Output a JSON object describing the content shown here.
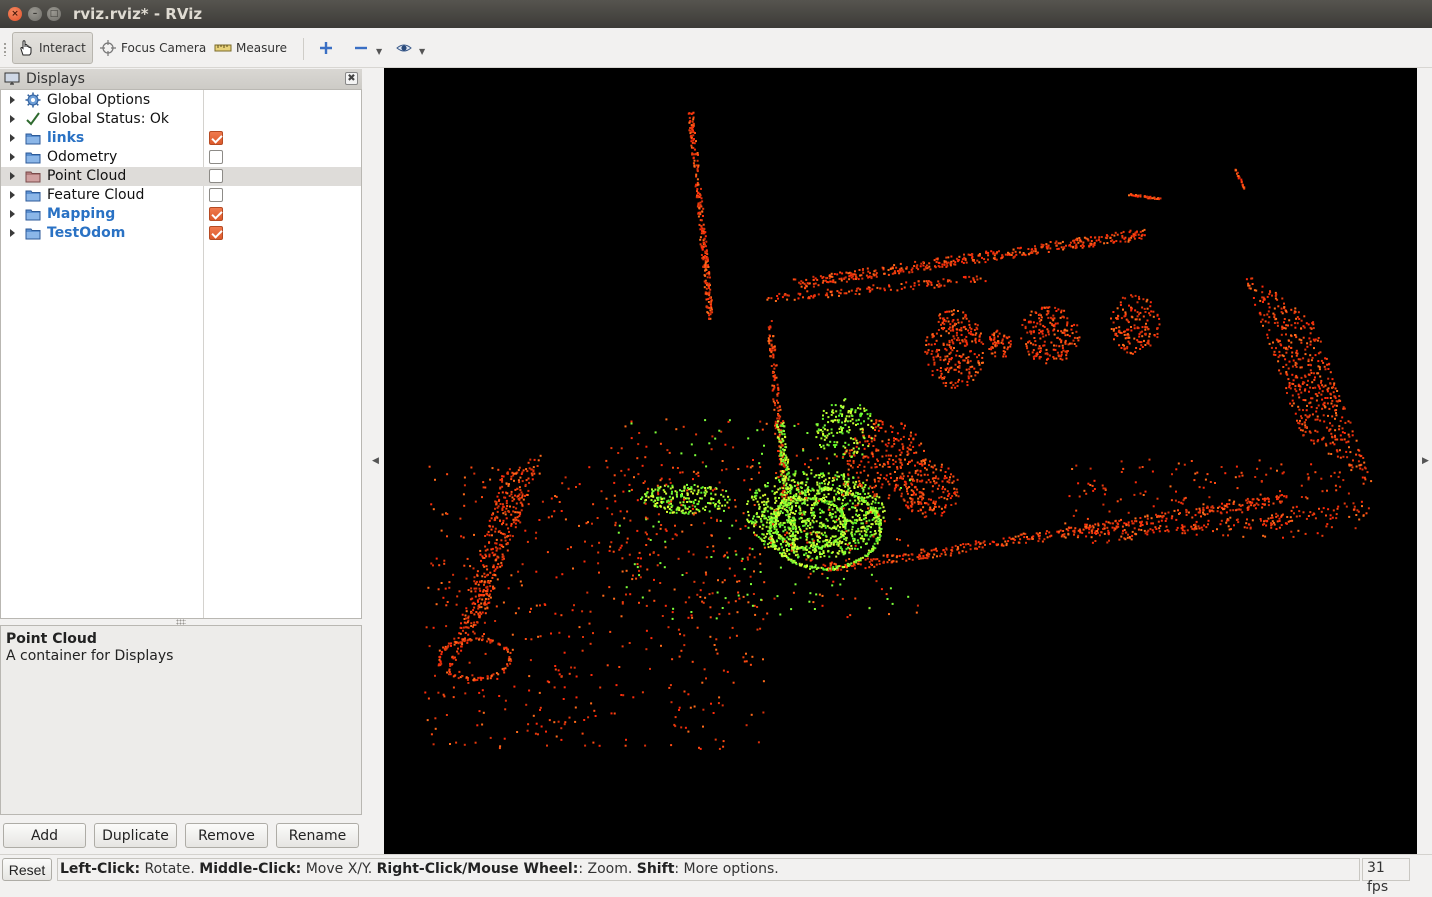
{
  "window": {
    "title": "rviz.rviz* - RViz",
    "close_glyph": "×",
    "min_glyph": "–",
    "max_glyph": "□"
  },
  "toolbar": {
    "interact": "Interact",
    "focus_camera": "Focus Camera",
    "measure": "Measure"
  },
  "displays_panel": {
    "title": "Displays",
    "close_glyph": "✖",
    "items": [
      {
        "label": "Global Options",
        "icon": "gear-icon"
      },
      {
        "label": "Global Status: Ok",
        "icon": "checkmark-icon"
      },
      {
        "label": "links",
        "icon": "folder-icon",
        "checked": true,
        "highlight": true
      },
      {
        "label": "Odometry",
        "icon": "folder-icon",
        "checked": false
      },
      {
        "label": "Point Cloud",
        "icon": "folder-icon",
        "checked": false,
        "selected": true
      },
      {
        "label": "Feature Cloud",
        "icon": "folder-icon",
        "checked": false
      },
      {
        "label": "Mapping",
        "icon": "folder-icon",
        "checked": true,
        "highlight": true
      },
      {
        "label": "TestOdom",
        "icon": "folder-icon",
        "checked": true,
        "highlight": true
      }
    ],
    "description": {
      "title": "Point Cloud",
      "text": "A container for Displays"
    },
    "buttons": {
      "add": "Add",
      "duplicate": "Duplicate",
      "remove": "Remove",
      "rename": "Rename"
    }
  },
  "statusbar": {
    "reset": "Reset",
    "hint_left_click": "Left-Click:",
    "hint_rotate": " Rotate. ",
    "hint_middle_click": "Middle-Click:",
    "hint_move": " Move X/Y. ",
    "hint_right_click": "Right-Click/Mouse Wheel:",
    "hint_zoom": ": Zoom. ",
    "hint_shift": "Shift",
    "hint_more": ": More options.",
    "fps": "31 fps"
  },
  "colors": {
    "accent_orange": "#dc5a2c",
    "cloud_green": "#7cff3a",
    "cloud_red": "#ff3a10",
    "link_blue": "#2a72c4"
  }
}
